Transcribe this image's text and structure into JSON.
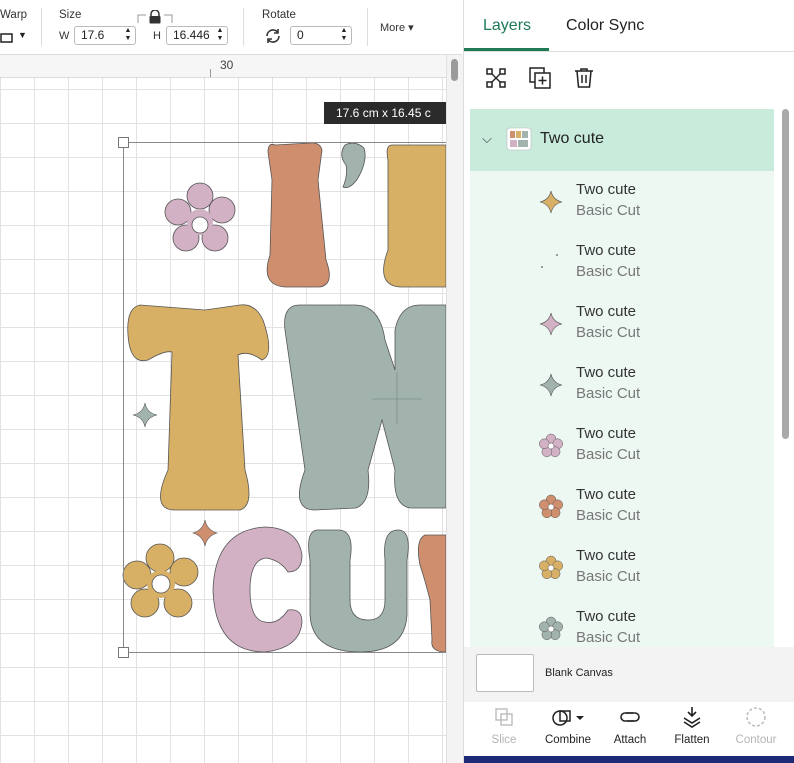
{
  "toolbar": {
    "warp_label": "Warp",
    "size_label": "Size",
    "w_label": "W",
    "w_value": "17.6",
    "h_label": "H",
    "h_value": "16.446",
    "rotate_label": "Rotate",
    "rotate_value": "0",
    "more_label": "More ▾"
  },
  "canvas": {
    "ruler_mark": "30",
    "dimension_tooltip": "17.6  cm x 16.45  c"
  },
  "panel": {
    "tabs": [
      {
        "label": "Layers",
        "active": true
      },
      {
        "label": "Color Sync",
        "active": false
      }
    ],
    "accent_color": "#1e7a55",
    "group": {
      "name": "Two cute"
    },
    "layers": [
      {
        "name": "Two cute",
        "type": "Basic Cut",
        "icon": "sparkle-icon",
        "color": "#d7b066"
      },
      {
        "name": "Two cute",
        "type": "Basic Cut",
        "icon": "dots-icon",
        "color": "#333333"
      },
      {
        "name": "Two cute",
        "type": "Basic Cut",
        "icon": "sparkle-icon",
        "color": "#d2b1c4"
      },
      {
        "name": "Two cute",
        "type": "Basic Cut",
        "icon": "sparkle-icon",
        "color": "#a2b3ae"
      },
      {
        "name": "Two cute",
        "type": "Basic Cut",
        "icon": "flower-icon",
        "color": "#d2b1c4"
      },
      {
        "name": "Two cute",
        "type": "Basic Cut",
        "icon": "flower-icon",
        "color": "#cf8e6e"
      },
      {
        "name": "Two cute",
        "type": "Basic Cut",
        "icon": "flower-icon",
        "color": "#d7b066"
      },
      {
        "name": "Two cute",
        "type": "Basic Cut",
        "icon": "flower-icon",
        "color": "#a2b3ae"
      }
    ],
    "blank_canvas_label": "Blank Canvas",
    "actions": [
      {
        "label": "Slice",
        "enabled": false
      },
      {
        "label": "Combine",
        "enabled": true
      },
      {
        "label": "Attach",
        "enabled": true
      },
      {
        "label": "Flatten",
        "enabled": true
      },
      {
        "label": "Contour",
        "enabled": false
      }
    ]
  }
}
